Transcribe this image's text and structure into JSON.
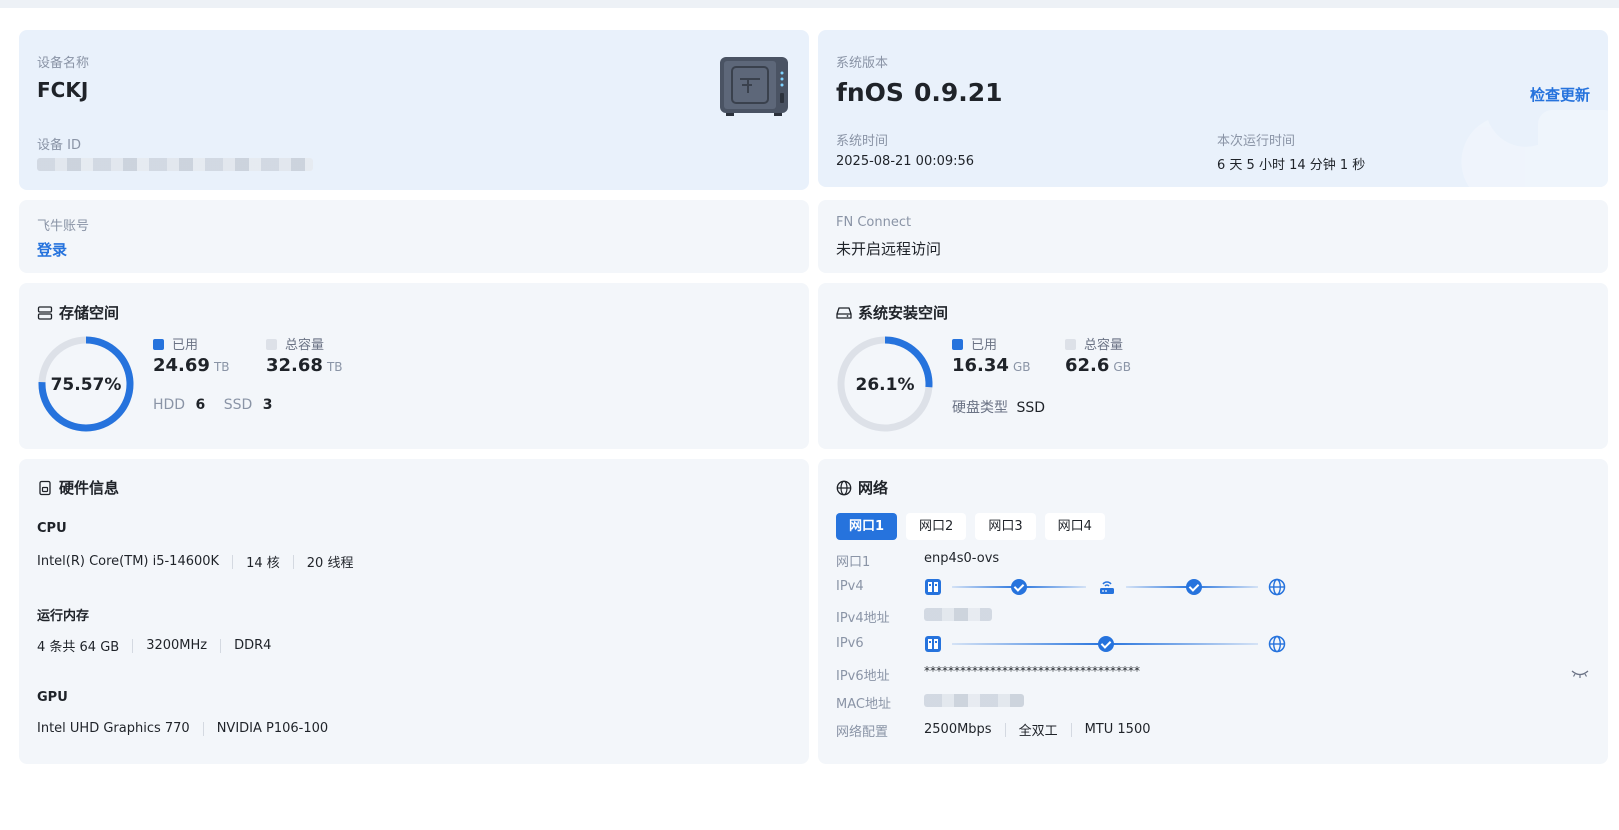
{
  "device": {
    "name_label": "设备名称",
    "name": "FCKJ",
    "id_label": "设备 ID"
  },
  "system": {
    "version_label": "系统版本",
    "os": "fnOS",
    "version": "0.9.21",
    "check_update": "检查更新",
    "time_label": "系统时间",
    "time": "2025-08-21 00:09:56",
    "uptime_label": "本次运行时间",
    "uptime": "6 天 5 小时 14 分钟 1 秒"
  },
  "account": {
    "label": "飞牛账号",
    "login": "登录"
  },
  "fn_connect": {
    "label": "FN Connect",
    "status": "未开启远程访问"
  },
  "storage": {
    "title": "存储空间",
    "percent_text": "75.57%",
    "percent": 75.57,
    "used_label": "已用",
    "used_value": "24.69",
    "used_unit": "TB",
    "total_label": "总容量",
    "total_value": "32.68",
    "total_unit": "TB",
    "hdd_label": "HDD",
    "hdd_count": "6",
    "ssd_label": "SSD",
    "ssd_count": "3"
  },
  "system_space": {
    "title": "系统安装空间",
    "percent_text": "26.1%",
    "percent": 26.1,
    "used_label": "已用",
    "used_value": "16.34",
    "used_unit": "GB",
    "total_label": "总容量",
    "total_value": "62.6",
    "total_unit": "GB",
    "disk_type_label": "硬盘类型",
    "disk_type": "SSD"
  },
  "hardware": {
    "title": "硬件信息",
    "cpu_label": "CPU",
    "cpu_model": "Intel(R) Core(TM) i5-14600K",
    "cpu_cores": "14 核",
    "cpu_threads": "20 线程",
    "mem_label": "运行内存",
    "mem_size": "4 条共 64 GB",
    "mem_speed": "3200MHz",
    "mem_type": "DDR4",
    "gpu_label": "GPU",
    "gpu1": "Intel UHD Graphics 770",
    "gpu2": "NVIDIA P106-100"
  },
  "network": {
    "title": "网络",
    "tabs": [
      "网口1",
      "网口2",
      "网口3",
      "网口4"
    ],
    "active_tab": 0,
    "port_label": "网口1",
    "port_value": "enp4s0-ovs",
    "ipv4_label": "IPv4",
    "ipv4_addr_label": "IPv4地址",
    "ipv6_label": "IPv6",
    "ipv6_addr_label": "IPv6地址",
    "ipv6_addr": "************************************",
    "mac_label": "MAC地址",
    "config_label": "网络配置",
    "speed": "2500Mbps",
    "duplex": "全双工",
    "mtu": "MTU 1500"
  },
  "colors": {
    "accent": "#2673dd",
    "ring_track": "#dde1e8",
    "card_bg": "#f3f6fa",
    "card_blue_bg": "#e9f1fb"
  }
}
